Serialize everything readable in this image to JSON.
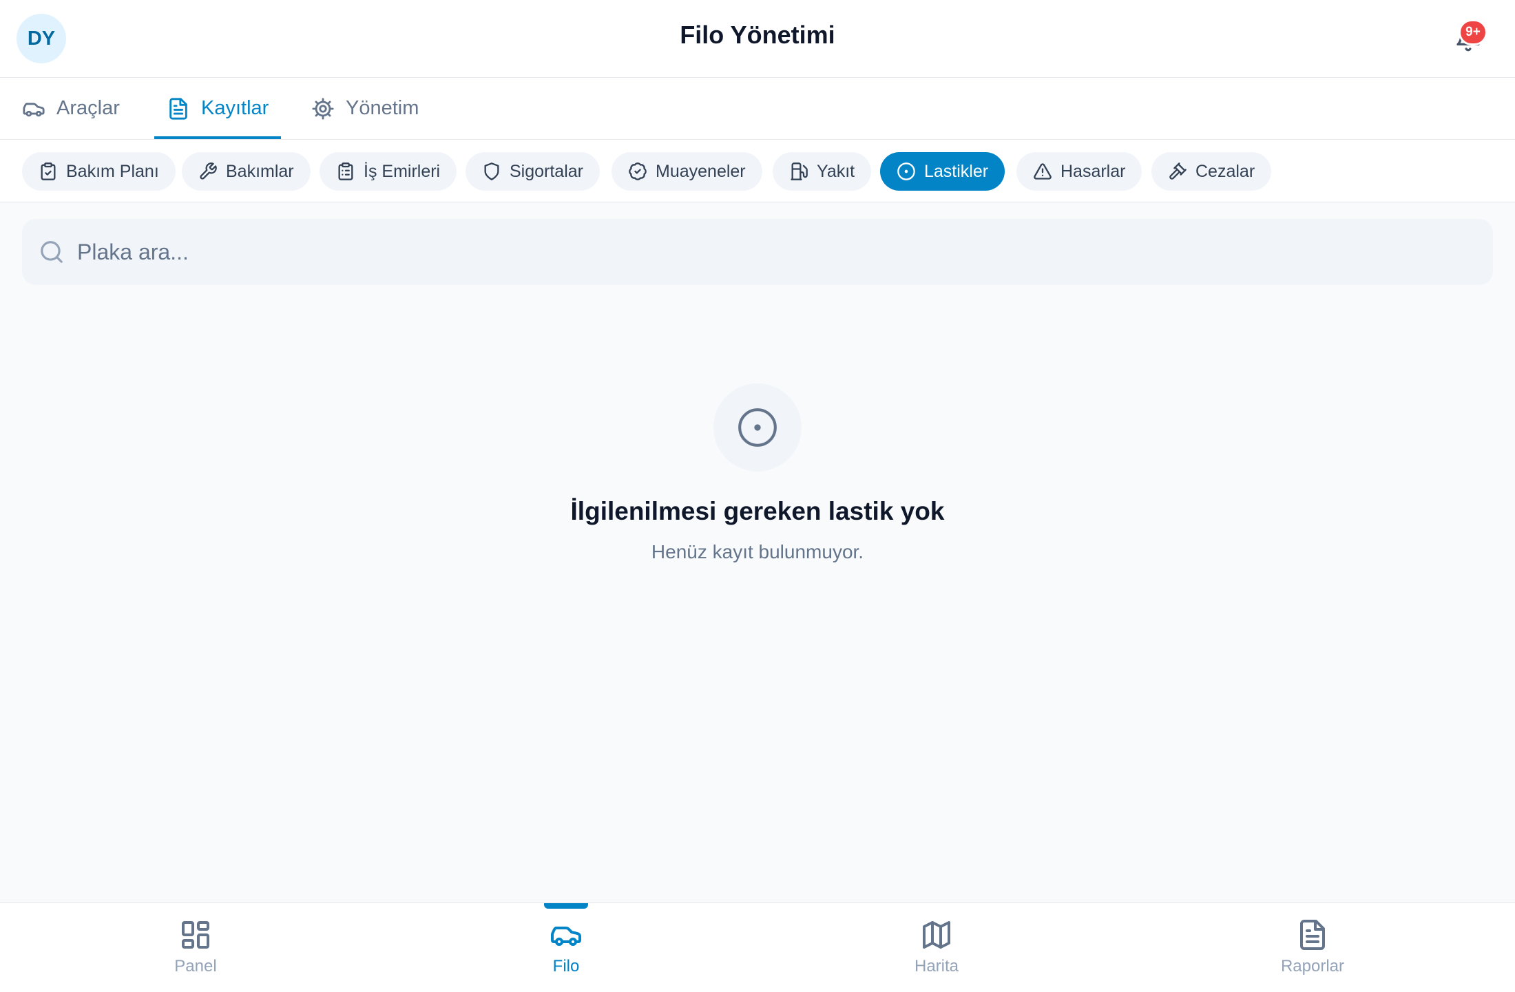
{
  "header": {
    "avatar_initials": "DY",
    "title": "Filo Yönetimi",
    "notification_badge": "9+"
  },
  "tabs": [
    {
      "label": "Araçlar",
      "icon": "car-icon"
    },
    {
      "label": "Kayıtlar",
      "icon": "document-icon",
      "active": true
    },
    {
      "label": "Yönetim",
      "icon": "gear-icon"
    }
  ],
  "chips": [
    {
      "label": "Bakım Planı",
      "icon": "clipboard-check-icon"
    },
    {
      "label": "Bakımlar",
      "icon": "wrench-icon"
    },
    {
      "label": "İş Emirleri",
      "icon": "clipboard-list-icon"
    },
    {
      "label": "Sigortalar",
      "icon": "shield-icon"
    },
    {
      "label": "Muayeneler",
      "icon": "badge-check-icon"
    },
    {
      "label": "Yakıt",
      "icon": "fuel-icon"
    },
    {
      "label": "Lastikler",
      "icon": "tire-icon",
      "active": true
    },
    {
      "label": "Hasarlar",
      "icon": "warning-icon"
    },
    {
      "label": "Cezalar",
      "icon": "gavel-icon"
    }
  ],
  "search": {
    "placeholder": "Plaka ara...",
    "value": ""
  },
  "empty_state": {
    "icon": "tire-icon",
    "title": "İlgilenilmesi gereken lastik yok",
    "subtitle": "Henüz kayıt bulunmuyor."
  },
  "bottom_nav": [
    {
      "label": "Panel",
      "icon": "dashboard-icon"
    },
    {
      "label": "Filo",
      "icon": "car-icon",
      "active": true
    },
    {
      "label": "Harita",
      "icon": "map-icon"
    },
    {
      "label": "Raporlar",
      "icon": "report-icon"
    }
  ],
  "colors": {
    "accent": "#0284c7",
    "badge": "#ef4444",
    "chip_bg": "#f1f5f9",
    "page_bg": "#f8fafc"
  }
}
